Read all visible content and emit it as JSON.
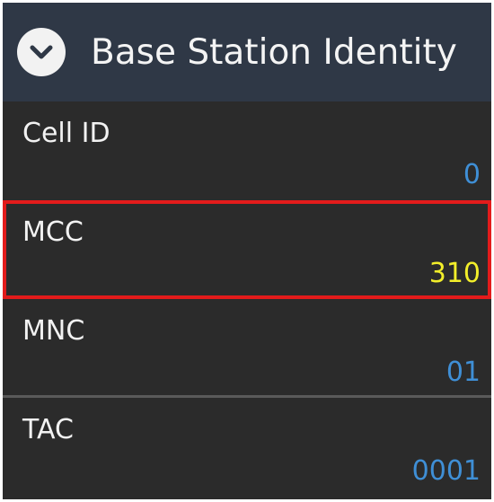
{
  "panel": {
    "title": "Base Station Identity",
    "icon": "chevron-down-icon"
  },
  "fields": [
    {
      "key": "cell-id",
      "label": "Cell ID",
      "value": "0"
    },
    {
      "key": "mcc",
      "label": "MCC",
      "value": "310",
      "highlighted": true
    },
    {
      "key": "mnc",
      "label": "MNC",
      "value": "01"
    },
    {
      "key": "tac",
      "label": "TAC",
      "value": "0001"
    }
  ],
  "colors": {
    "header_bg": "#2f3846",
    "panel_bg": "#2b2b2b",
    "value_blue": "#3f8fd6",
    "value_yellow": "#f2ee2a",
    "highlight_red": "#e31b1b"
  }
}
